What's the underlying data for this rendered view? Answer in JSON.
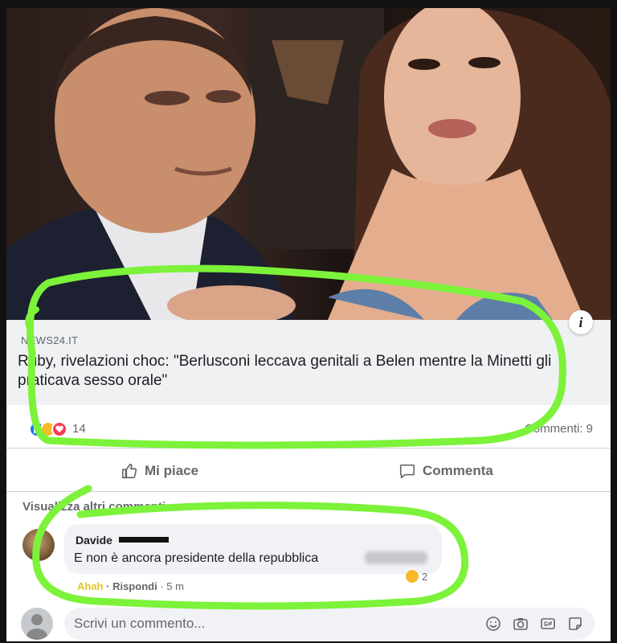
{
  "post": {
    "source": "NEWS24.IT",
    "headline": "Ruby, rivelazioni choc: \"Berlusconi leccava genitali a Belen mentre la Minetti gli praticava sesso orale\"",
    "info_icon": "i",
    "reaction_count": "14",
    "comments_count": "Commenti: 9"
  },
  "actions": {
    "like_label": "Mi piace",
    "comment_label": "Commenta"
  },
  "comments": {
    "view_more": "Visualizza altri commenti",
    "items": [
      {
        "author": "Davide",
        "text": "E non è ancora presidente della repubblica",
        "reaction": "Ahah",
        "reply": "Rispondi",
        "time": "5 m",
        "reaction_count": "2"
      }
    ],
    "compose_placeholder": "Scrivi un commento..."
  },
  "colors": {
    "marker_green": "#7cf23a",
    "facebook_blue": "#1877f2"
  },
  "icons": [
    "info-icon",
    "like-icon",
    "comment-icon",
    "emoji-icon",
    "camera-icon",
    "gif-icon",
    "sticker-icon"
  ]
}
